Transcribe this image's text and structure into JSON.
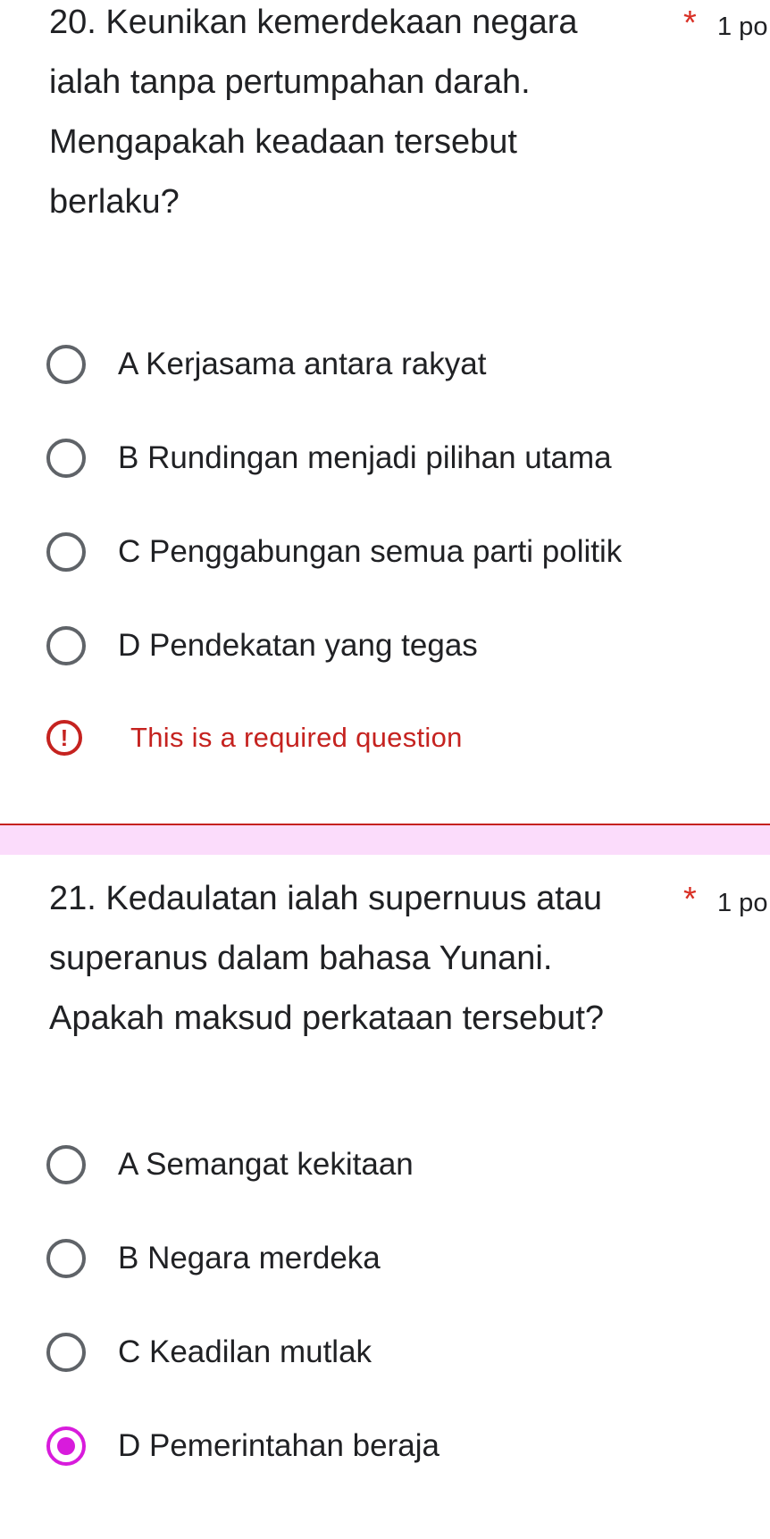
{
  "accent_color": "#d81bdc",
  "error_color": "#c5221f",
  "questions": [
    {
      "text": "20. Keunikan kemerdekaan negara ialah tanpa pertumpahan darah. Mengapakah keadaan tersebut berlaku?",
      "required_mark": "*",
      "points": "1 po",
      "options": [
        {
          "label": "A Kerjasama antara rakyat",
          "selected": false
        },
        {
          "label": "B Rundingan menjadi pilihan utama",
          "selected": false
        },
        {
          "label": "C Penggabungan semua parti politik",
          "selected": false
        },
        {
          "label": "D Pendekatan yang tegas",
          "selected": false
        }
      ],
      "error": {
        "icon": "!",
        "icon_name": "error-icon",
        "text": "This is a required question"
      }
    },
    {
      "text": "21. Kedaulatan ialah supernuus atau superanus dalam bahasa Yunani. Apakah maksud perkataan tersebut?",
      "required_mark": "*",
      "points": "1 po",
      "options": [
        {
          "label": "A Semangat kekitaan",
          "selected": false
        },
        {
          "label": "B Negara merdeka",
          "selected": false
        },
        {
          "label": "C Keadilan mutlak",
          "selected": false
        },
        {
          "label": "D Pemerintahan beraja",
          "selected": true
        }
      ]
    }
  ]
}
